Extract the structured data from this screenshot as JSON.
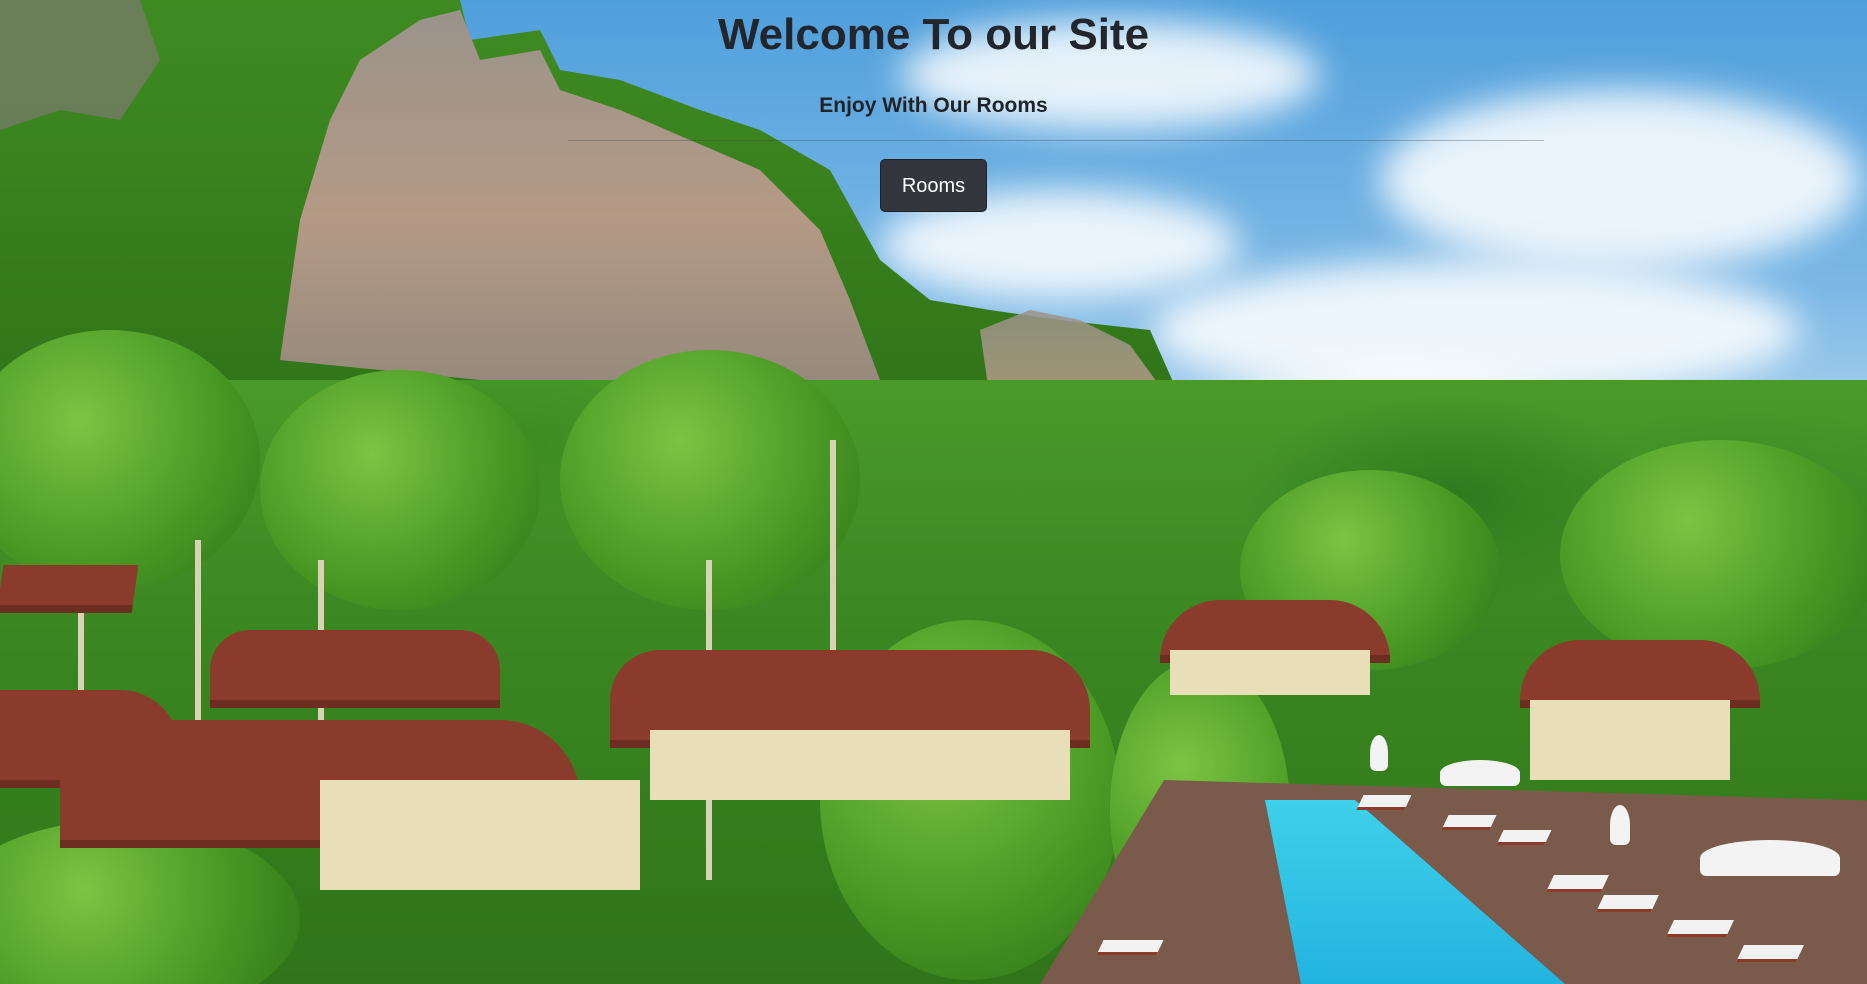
{
  "hero": {
    "title": "Welcome To our Site",
    "subtitle": "Enjoy With Our Rooms",
    "button_label": "Rooms",
    "background_image": "tropical resort with limestone cliff, palm trees and swimming pool"
  },
  "colors": {
    "title_text": "#22252b",
    "button_bg": "#33363c",
    "button_text": "#ffffff",
    "sky": "#4f9fdc",
    "roof": "#8a3b2c",
    "pool": "#22b4e0"
  }
}
